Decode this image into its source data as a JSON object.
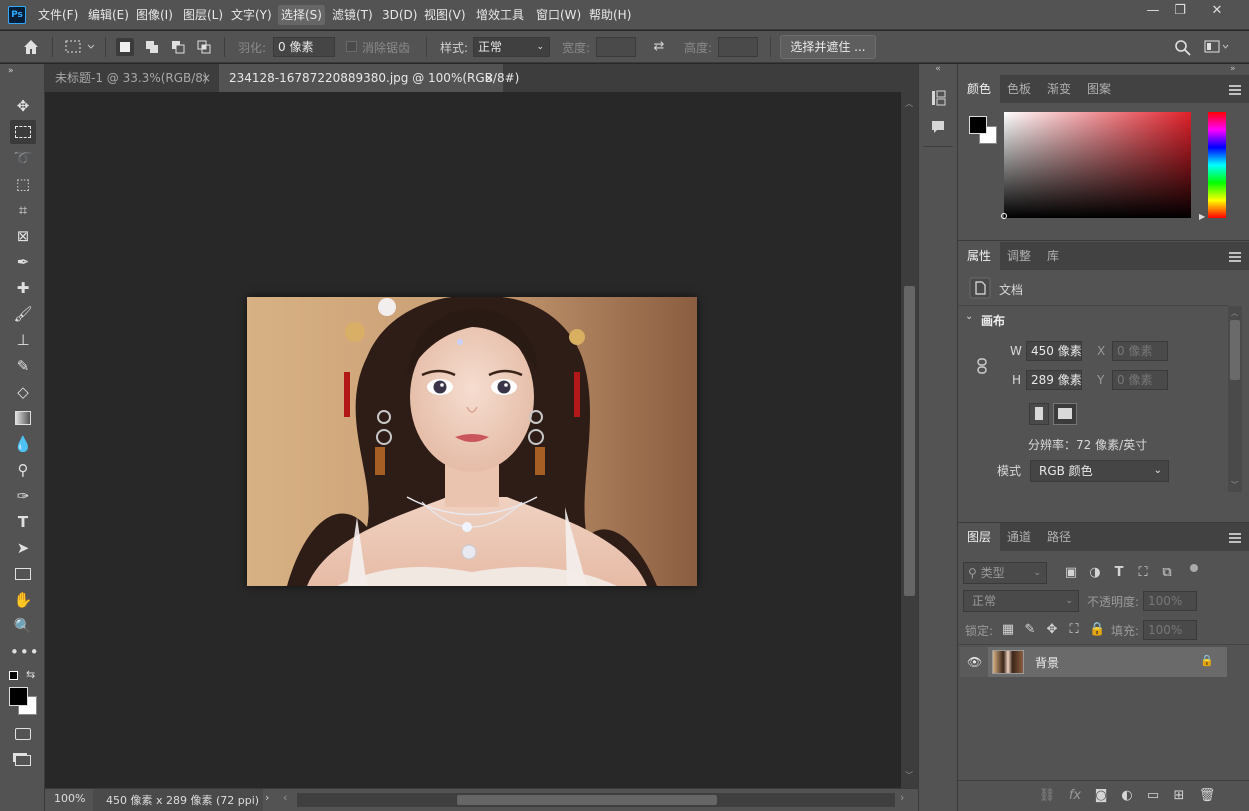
{
  "app": {
    "logo": "Ps"
  },
  "menu": {
    "items": [
      "文件(F)",
      "编辑(E)",
      "图像(I)",
      "图层(L)",
      "文字(Y)",
      "选择(S)",
      "滤镜(T)",
      "3D(D)",
      "视图(V)",
      "增效工具",
      "窗口(W)",
      "帮助(H)"
    ],
    "active": "选择(S)",
    "window_buttons": {
      "minimize": "—",
      "restore": "❐",
      "close": "✕"
    }
  },
  "options": {
    "feather_label": "羽化:",
    "feather_value": "0 像素",
    "antialias_label": "消除锯齿",
    "style_label": "样式:",
    "style_value": "正常",
    "width_label": "宽度:",
    "height_label": "高度:",
    "select_mask_button": "选择并遮住 ..."
  },
  "tabs": [
    {
      "label": "未标题-1 @ 33.3%(RGB/8)",
      "close": "×",
      "active": false
    },
    {
      "label": "234128-16787220889380.jpg @ 100%(RGB/8#)",
      "close": "×",
      "active": true
    }
  ],
  "tools": [
    "move-icon",
    "marquee-icon",
    "lasso-icon",
    "object-select-icon",
    "crop-icon",
    "frame-icon",
    "eyedropper-icon",
    "healing-icon",
    "brush-icon",
    "stamp-icon",
    "history-brush-icon",
    "eraser-icon",
    "gradient-icon",
    "blur-icon",
    "dodge-icon",
    "pen-icon",
    "type-icon",
    "path-select-icon",
    "rectangle-icon",
    "hand-icon",
    "zoom-icon",
    "more-icon"
  ],
  "status": {
    "zoom": "100%",
    "doc_info": "450 像素 x 289 像素 (72 ppi)"
  },
  "color_panel": {
    "tabs": [
      "颜色",
      "色板",
      "渐变",
      "图案"
    ],
    "foreground": "#000000",
    "background": "#ffffff"
  },
  "properties_panel": {
    "tabs": [
      "属性",
      "调整",
      "库"
    ],
    "doc_label": "文档",
    "section": "画布",
    "w_label": "W",
    "w_value": "450 像素",
    "h_label": "H",
    "h_value": "289 像素",
    "x_label": "X",
    "x_placeholder": "0 像素",
    "y_label": "Y",
    "y_placeholder": "0 像素",
    "resolution": "分辨率：72 像素/英寸",
    "mode_label": "模式",
    "mode_value": "RGB 颜色"
  },
  "layers_panel": {
    "tabs": [
      "图层",
      "通道",
      "路径"
    ],
    "filter_placeholder": "类型",
    "blend_mode": "正常",
    "opacity_label": "不透明度:",
    "opacity_value": "100%",
    "lock_label": "锁定:",
    "fill_label": "填充:",
    "fill_value": "100%",
    "layers": [
      {
        "name": "背景",
        "locked": true,
        "visible": true
      }
    ],
    "bottom_icons": [
      "link-icon",
      "fx-icon",
      "mask-icon",
      "adjustment-icon",
      "group-icon",
      "new-layer-icon",
      "trash-icon"
    ]
  }
}
